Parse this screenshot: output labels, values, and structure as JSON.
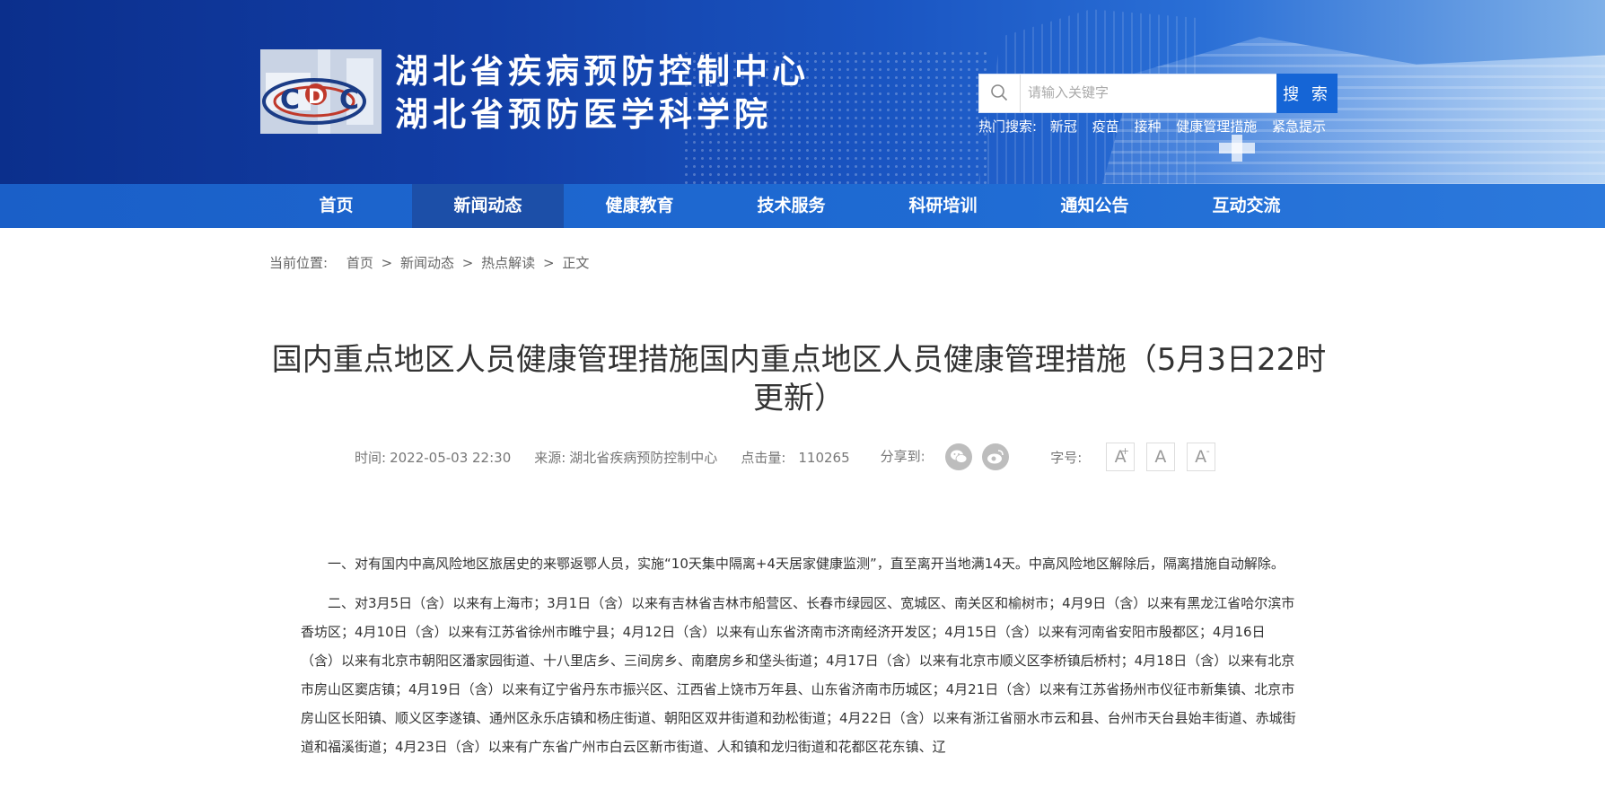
{
  "header": {
    "title_line1": "湖北省疾病预防控制中心",
    "title_line2": "湖北省预防医学科学院",
    "search": {
      "placeholder": "请输入关键字",
      "button_label": "搜 索"
    },
    "hot_search": {
      "label": "热门搜索:",
      "items": [
        "新冠",
        "疫苗",
        "接种",
        "健康管理措施",
        "紧急提示"
      ]
    }
  },
  "nav": {
    "items": [
      "首页",
      "新闻动态",
      "健康教育",
      "技术服务",
      "科研培训",
      "通知公告",
      "互动交流"
    ],
    "active_index": 1
  },
  "breadcrumb": {
    "prefix": "当前位置:",
    "items": [
      "首页",
      "新闻动态",
      "热点解读",
      "正文"
    ],
    "separator": ">"
  },
  "article": {
    "title": "国内重点地区人员健康管理措施国内重点地区人员健康管理措施（5月3日22时更新）",
    "meta": {
      "time_label": "时间:",
      "time_value": "2022-05-03 22:30",
      "source_label": "来源:",
      "source_value": "湖北省疾病预防控制中心",
      "clicks_label": "点击量:",
      "clicks_value": "110265",
      "share_label": "分享到:",
      "font_label": "字号:"
    },
    "paragraphs": [
      "一、对有国内中高风险地区旅居史的来鄂返鄂人员，实施“10天集中隔离+4天居家健康监测”，直至离开当地满14天。中高风险地区解除后，隔离措施自动解除。",
      "二、对3月5日（含）以来有上海市；3月1日（含）以来有吉林省吉林市船营区、长春市绿园区、宽城区、南关区和榆树市；4月9日（含）以来有黑龙江省哈尔滨市香坊区；4月10日（含）以来有江苏省徐州市睢宁县；4月12日（含）以来有山东省济南市济南经济开发区；4月15日（含）以来有河南省安阳市殷都区；4月16日（含）以来有北京市朝阳区潘家园街道、十八里店乡、三间房乡、南磨房乡和垡头街道；4月17日（含）以来有北京市顺义区李桥镇后桥村；4月18日（含）以来有北京市房山区窦店镇；4月19日（含）以来有辽宁省丹东市振兴区、江西省上饶市万年县、山东省济南市历城区；4月21日（含）以来有江苏省扬州市仪征市新集镇、北京市房山区长阳镇、顺义区李遂镇、通州区永乐店镇和杨庄街道、朝阳区双井街道和劲松街道；4月22日（含）以来有浙江省丽水市云和县、台州市天台县始丰街道、赤城街道和福溪街道；4月23日（含）以来有广东省广州市白云区新市街道、人和镇和龙归街道和花都区花东镇、辽"
    ]
  },
  "colors": {
    "nav_bg": "#1f6bd3",
    "nav_active": "#1c4fa8",
    "search_button": "#1565d6"
  }
}
